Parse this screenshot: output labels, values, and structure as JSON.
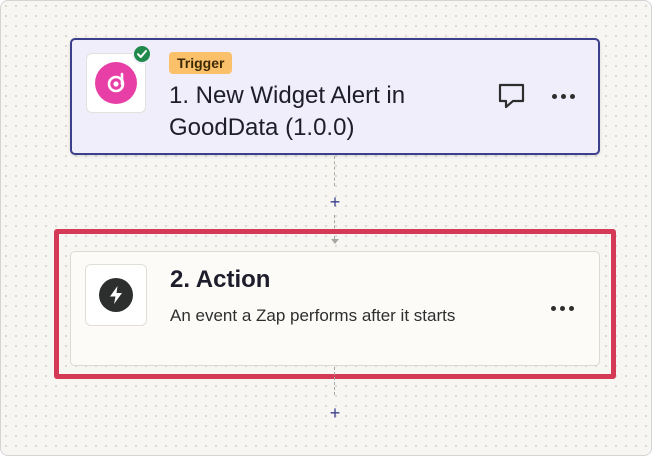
{
  "trigger": {
    "badge": "Trigger",
    "title": "1. New Widget Alert in GoodData (1.0.0)",
    "app_icon": "gooddata-logo",
    "status_icon": "check-icon",
    "comment_icon": "comment-icon",
    "more_icon": "more-options-icon",
    "colors": {
      "badge_bg": "#fbc16a",
      "border": "#3b3f8c",
      "logo": "#e83fa6",
      "check": "#1f8a4c"
    }
  },
  "connectors": [
    {
      "plus_label": "+"
    },
    {
      "plus_label": "+"
    }
  ],
  "action": {
    "title": "2. Action",
    "description": "An event a Zap performs after it starts",
    "app_icon": "lightning-bolt-icon",
    "more_icon": "more-options-icon",
    "colors": {
      "highlight": "#d43a55"
    }
  }
}
